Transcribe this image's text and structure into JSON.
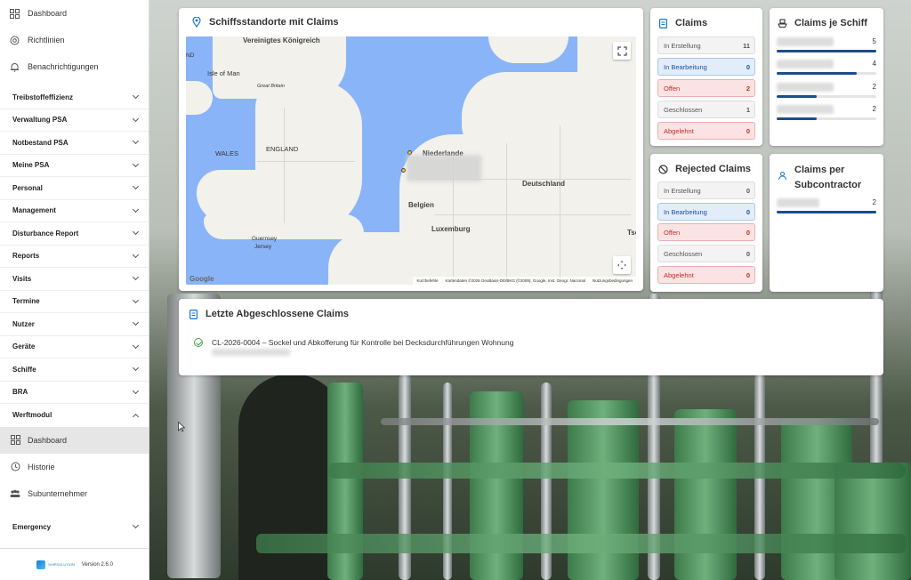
{
  "sidebar": {
    "top_items": [
      {
        "label": "Dashboard",
        "icon": "dashboard-icon"
      },
      {
        "label": "Richtlinien",
        "icon": "at-icon"
      },
      {
        "label": "Benachrichtigungen",
        "icon": "bell-icon"
      }
    ],
    "groups": [
      "Treibstoffeffizienz",
      "Verwaltung PSA",
      "Notbestand PSA",
      "Meine PSA",
      "Personal",
      "Management",
      "Disturbance Report",
      "Reports",
      "Visits",
      "Termine",
      "Nutzer",
      "Geräte",
      "Schiffe",
      "BRA"
    ],
    "werftmodul": {
      "label": "Werftmodul",
      "items": [
        {
          "label": "Dashboard",
          "icon": "dashboard-icon",
          "active": true
        },
        {
          "label": "Historie",
          "icon": "history-icon"
        },
        {
          "label": "Subunternehmer",
          "icon": "group-icon"
        }
      ]
    },
    "emergency": "Emergency",
    "footer": {
      "logo_text": "SHIPSOLUTION",
      "version": "Version 2.6.0"
    }
  },
  "map_card": {
    "title": "Schiffsstandorte mit Claims",
    "labels": {
      "uk": "Vereinigtes Königreich",
      "isle_of_man": "Isle of Man",
      "great_britain": "Great Britain",
      "england": "ENGLAND",
      "wales": "WALES",
      "nl": "Niederlande",
      "de": "Deutschland",
      "be": "Belgien",
      "lu": "Luxemburg",
      "gg": "Guernsey",
      "je": "Jersey",
      "nd": "ND",
      "ts": "Tsc"
    },
    "google": "Google",
    "attribution": [
      "Kurzbefehle",
      "Kartendaten ©2026 GeoBasis-DE/BKG (©2009), Google, Inst. Geogr. Nacional",
      "Nutzungsbedingungen"
    ]
  },
  "claims_card": {
    "title": "Claims",
    "rows": [
      {
        "label": "In Erstellung",
        "count": "11",
        "style": "grey"
      },
      {
        "label": "In Bearbeitung",
        "count": "0",
        "style": "blue"
      },
      {
        "label": "Offen",
        "count": "2",
        "style": "red"
      },
      {
        "label": "Geschlossen",
        "count": "1",
        "style": "grey"
      },
      {
        "label": "Abgelehnt",
        "count": "0",
        "style": "red"
      }
    ]
  },
  "rejected_card": {
    "title": "Rejected Claims",
    "rows": [
      {
        "label": "In Erstellung",
        "count": "0",
        "style": "grey"
      },
      {
        "label": "In Bearbeitung",
        "count": "0",
        "style": "blue"
      },
      {
        "label": "Offen",
        "count": "0",
        "style": "red"
      },
      {
        "label": "Geschlossen",
        "count": "0",
        "style": "grey"
      },
      {
        "label": "Abgelehnt",
        "count": "0",
        "style": "red"
      }
    ]
  },
  "ship_card": {
    "title": "Claims je Schiff",
    "items": [
      {
        "count": "5",
        "fraction": 1.0
      },
      {
        "count": "4",
        "fraction": 0.8
      },
      {
        "count": "2",
        "fraction": 0.4
      },
      {
        "count": "2",
        "fraction": 0.4
      }
    ]
  },
  "sub_card": {
    "title_line1": "Claims per",
    "title_line2": "Subcontractor",
    "items": [
      {
        "count": "2",
        "fraction": 1.0
      }
    ]
  },
  "closed_card": {
    "title": "Letzte Abgeschlossene Claims",
    "claim": "CL-2026-0004 – Sockel und Abkofferung für Kontrolle bei Decksdurchführungen Wohnung"
  },
  "colors": {
    "accent": "#1976d2",
    "bar": "#1b4d8a",
    "red": "#c62828",
    "blue": "#1a4fa0",
    "map_water": "#8ab4f8"
  }
}
